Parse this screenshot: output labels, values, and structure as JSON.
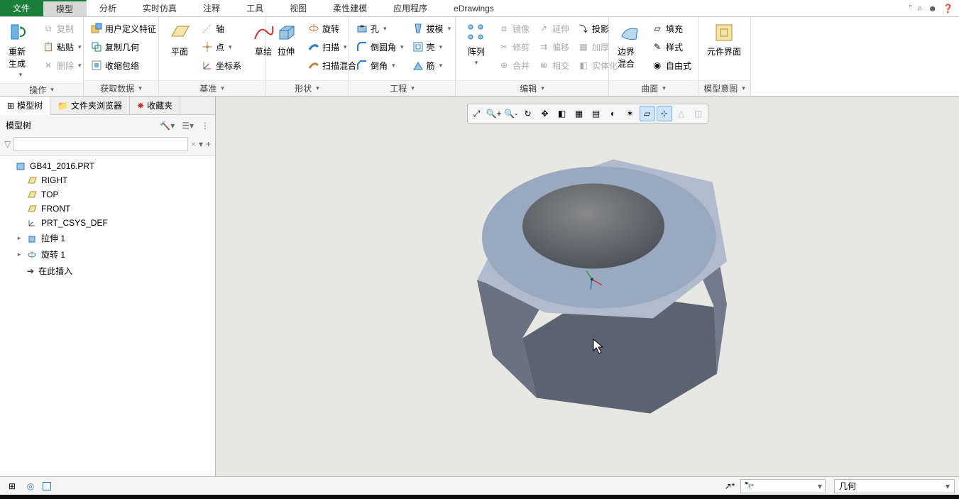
{
  "tabs": {
    "file": "文件",
    "list": [
      "模型",
      "分析",
      "实时仿真",
      "注释",
      "工具",
      "视图",
      "柔性建模",
      "应用程序",
      "eDrawings"
    ],
    "active": 0
  },
  "ribbon": {
    "g0": {
      "label": "操作",
      "regen": "重新生成",
      "copy": "复制",
      "paste": "粘贴",
      "delete": "删除"
    },
    "g1": {
      "label": "获取数据",
      "udf": "用户定义特征",
      "copygeo": "复制几何",
      "shrink": "收缩包络"
    },
    "g2": {
      "label": "基准",
      "plane": "平面",
      "sketch": "草绘",
      "axis": "轴",
      "point": "点",
      "csys": "坐标系"
    },
    "g3": {
      "label": "形状",
      "extrude": "拉伸",
      "revolve": "旋转",
      "sweep": "扫描",
      "sweepblend": "扫描混合"
    },
    "g4": {
      "label": "工程",
      "hole": "孔",
      "round": "倒圆角",
      "chamfer": "倒角",
      "draft": "拔模",
      "shell": "壳",
      "rib": "筋"
    },
    "g5": {
      "label": "编辑",
      "pattern": "阵列",
      "mirror": "镜像",
      "trim": "修剪",
      "merge": "合并",
      "extend": "延伸",
      "offset": "偏移",
      "intersect": "相交",
      "project": "投影",
      "thicken": "加厚",
      "solidify": "实体化"
    },
    "g6": {
      "label": "曲面",
      "boundary": "边界混合",
      "fill": "填充",
      "style": "样式",
      "freestyle": "自由式"
    },
    "g7": {
      "label": "模型意图",
      "compui": "元件界面"
    }
  },
  "side": {
    "tabs": [
      "模型树",
      "文件夹浏览器",
      "收藏夹"
    ],
    "title": "模型树",
    "filter_placeholder": "",
    "tree": [
      {
        "name": "GB41_2016.PRT",
        "icon": "part"
      },
      {
        "name": "RIGHT",
        "icon": "plane",
        "indent": 1
      },
      {
        "name": "TOP",
        "icon": "plane",
        "indent": 1
      },
      {
        "name": "FRONT",
        "icon": "plane",
        "indent": 1
      },
      {
        "name": "PRT_CSYS_DEF",
        "icon": "csys",
        "indent": 1
      },
      {
        "name": "拉伸 1",
        "icon": "extrude",
        "indent": 1,
        "exp": true
      },
      {
        "name": "旋转 1",
        "icon": "revolve",
        "indent": 1,
        "exp": true
      },
      {
        "name": "在此插入",
        "icon": "insert",
        "indent": 1
      }
    ]
  },
  "status": {
    "mode": "几何"
  }
}
